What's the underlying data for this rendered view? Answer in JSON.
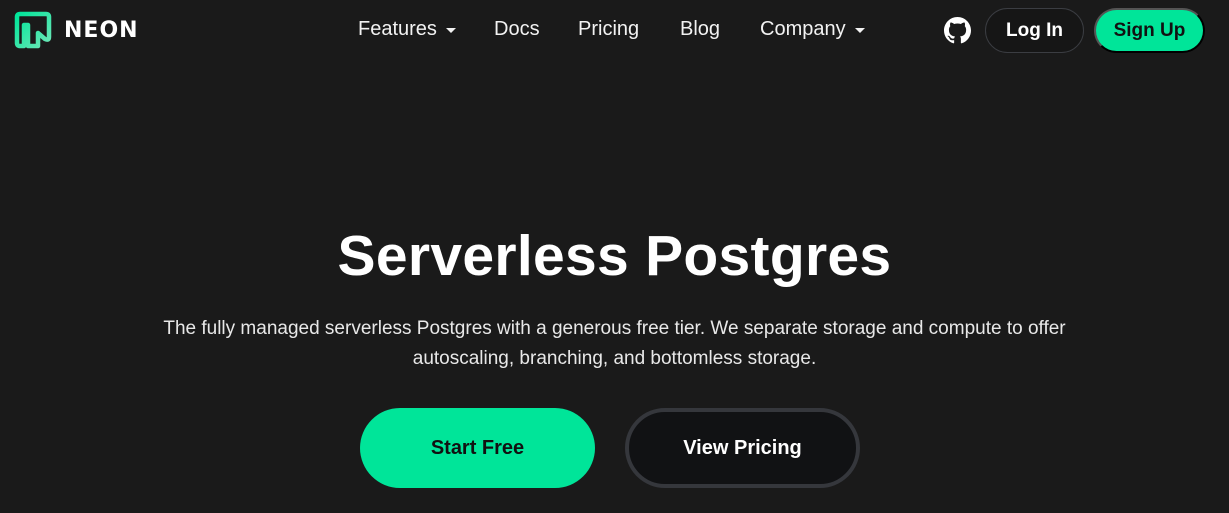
{
  "brand": {
    "name": "NEON",
    "logo_icon": "neon-logo-icon",
    "colors": {
      "accent": "#00e599",
      "background": "#1a1a1a"
    }
  },
  "nav": {
    "items": [
      {
        "label": "Features",
        "has_dropdown": true
      },
      {
        "label": "Docs",
        "has_dropdown": false
      },
      {
        "label": "Pricing",
        "has_dropdown": false
      },
      {
        "label": "Blog",
        "has_dropdown": false
      },
      {
        "label": "Company",
        "has_dropdown": true
      }
    ],
    "github_icon": "github-icon",
    "login_label": "Log In",
    "signup_label": "Sign Up"
  },
  "hero": {
    "title": "Serverless Postgres",
    "subtitle_line1": "The fully managed serverless Postgres with a generous free tier. We separate storage and compute to offer",
    "subtitle_line2": "autoscaling, branching, and bottomless storage.",
    "primary_cta": "Start Free",
    "secondary_cta": "View Pricing"
  }
}
